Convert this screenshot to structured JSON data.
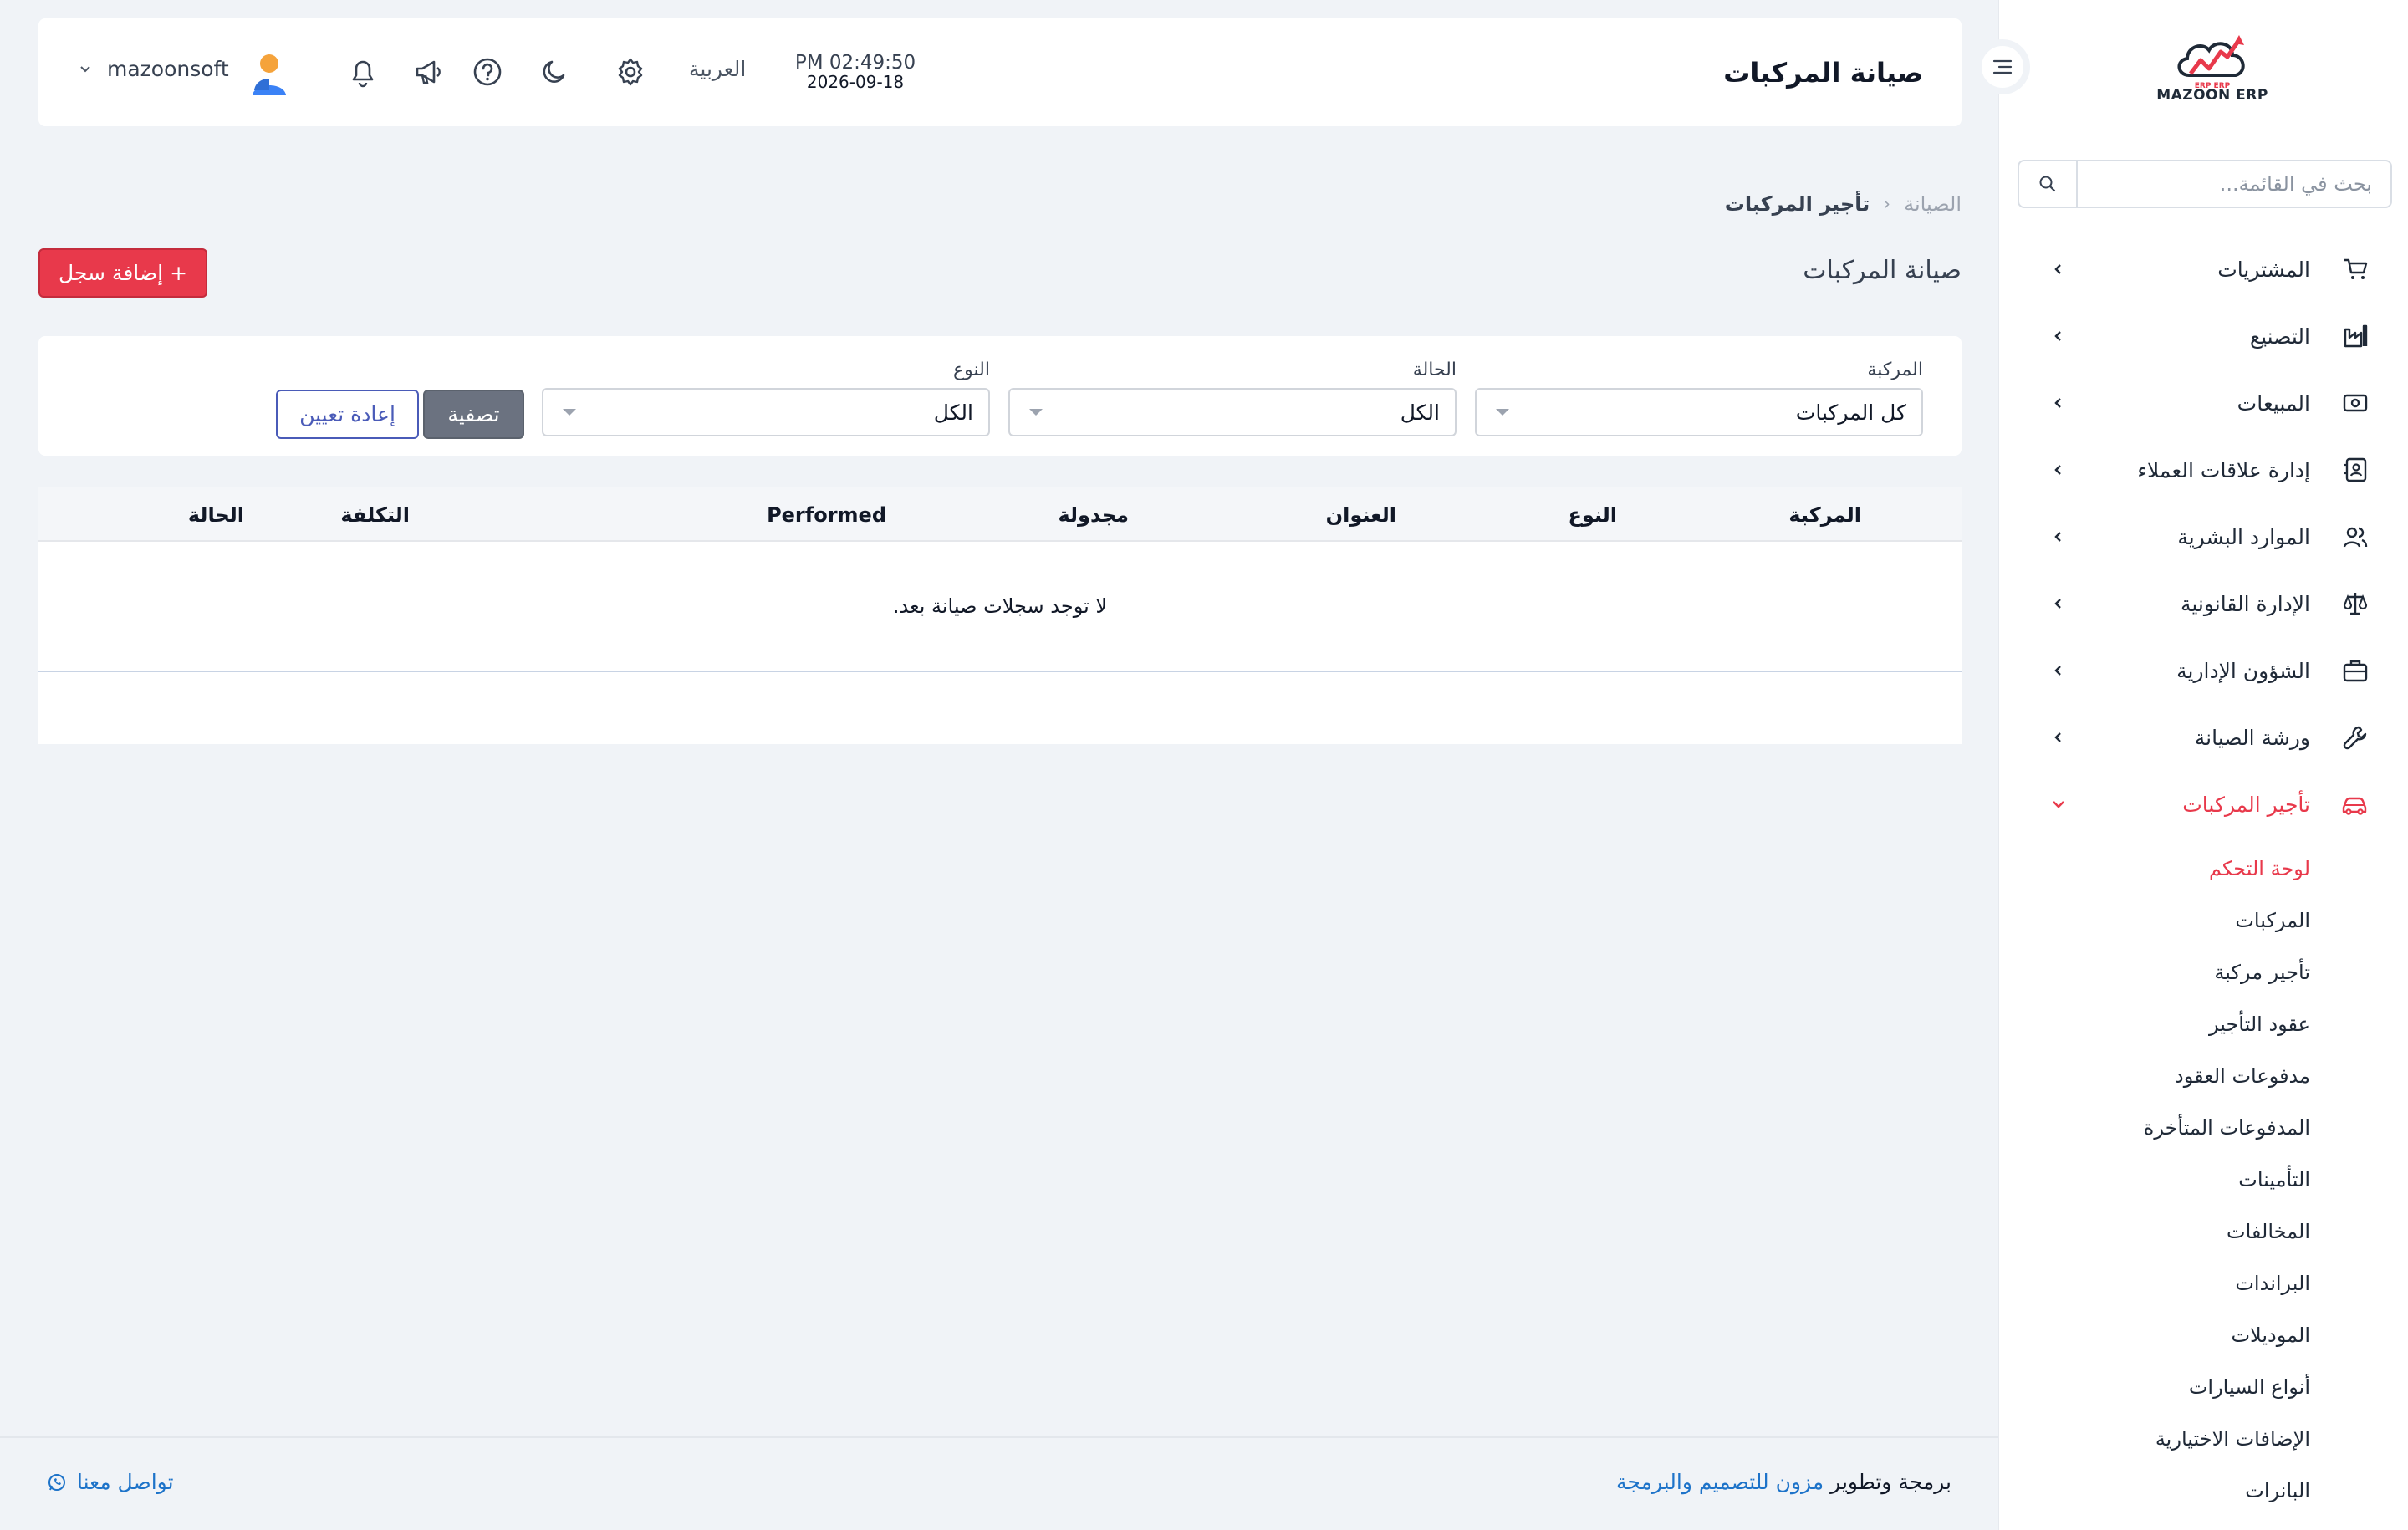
{
  "app": {
    "logo_text": "MAZOON ERP",
    "logo_subtext": "ERP ERP",
    "brand_color": "#e8394b",
    "accent_color": "#1d73c9"
  },
  "sidebar": {
    "search_placeholder": "بحث في القائمة...",
    "items": [
      {
        "label": "المشتريات",
        "icon": "cart-icon"
      },
      {
        "label": "التصنيع",
        "icon": "factory-icon"
      },
      {
        "label": "المبيعات",
        "icon": "cash-icon"
      },
      {
        "label": "إدارة علاقات العملاء",
        "icon": "contacts-icon"
      },
      {
        "label": "الموارد البشرية",
        "icon": "users-icon"
      },
      {
        "label": "الإدارة القانونية",
        "icon": "scale-icon"
      },
      {
        "label": "الشؤون الإدارية",
        "icon": "briefcase-icon"
      },
      {
        "label": "ورشة الصيانة",
        "icon": "wrench-icon"
      },
      {
        "label": "تأجير المركبات",
        "icon": "car-icon",
        "active": true
      }
    ],
    "subitems": [
      {
        "label": "لوحة التحكم",
        "active": true
      },
      {
        "label": "المركبات"
      },
      {
        "label": "تأجير مركبة"
      },
      {
        "label": "عقود التأجير"
      },
      {
        "label": "مدفوعات العقود"
      },
      {
        "label": "المدفوعات المتأخرة"
      },
      {
        "label": "التأمينات"
      },
      {
        "label": "المخالفات"
      },
      {
        "label": "البراندات"
      },
      {
        "label": "الموديلات"
      },
      {
        "label": "أنواع السيارات"
      },
      {
        "label": "الإضافات الاختيارية"
      },
      {
        "label": "البانرات"
      }
    ]
  },
  "header": {
    "title": "صيانة المركبات",
    "time": "PM 02:49:50",
    "date": "2026-09-18",
    "language": "العربية",
    "username": "mazoonsoft"
  },
  "breadcrumb": {
    "parent": "تأجير المركبات",
    "current": "الصيانة"
  },
  "page": {
    "section_title": "صيانة المركبات",
    "add_button": "إضافة سجل"
  },
  "filters": {
    "vehicle": {
      "label": "المركبة",
      "value": "كل المركبات"
    },
    "status": {
      "label": "الحالة",
      "value": "الكل"
    },
    "type": {
      "label": "النوع",
      "value": "الكل"
    },
    "filter_button": "تصفية",
    "reset_button": "إعادة تعيين"
  },
  "table": {
    "columns": [
      "المركبة",
      "النوع",
      "العنوان",
      "مجدولة",
      "Performed",
      "التكلفة",
      "الحالة"
    ],
    "empty_message": "لا توجد سجلات صيانة بعد."
  },
  "footer": {
    "credit_prefix": "برمجة وتطوير",
    "credit_link": "مزون للتصميم والبرمجة",
    "contact": "تواصل معنا"
  }
}
